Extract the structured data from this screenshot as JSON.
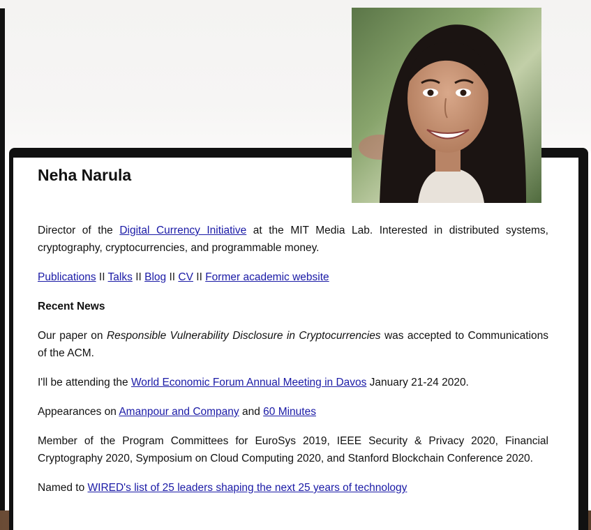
{
  "profile": {
    "name": "Neha Narula",
    "photo_alt": "portrait-photo"
  },
  "intro": {
    "before": "Director of the ",
    "link": "Digital Currency Initiative",
    "after": " at the MIT Media Lab. Interested in distributed systems, cryptography, cryptocurrencies, and programmable money."
  },
  "nav_links": {
    "separator": "II",
    "items": [
      "Publications",
      "Talks",
      "Blog",
      "CV",
      "Former academic website"
    ]
  },
  "news": {
    "heading": "Recent News",
    "item1": {
      "before": "Our paper on ",
      "title": "Responsible Vulnerability Disclosure in Cryptocurrencies",
      "after": " was accepted to Communications of the ACM."
    },
    "item2": {
      "before": "I'll be attending the ",
      "link": "World Economic Forum Annual Meeting in Davos",
      "after": " January 21-24 2020."
    },
    "item3": {
      "before": "Appearances on ",
      "link1": "Amanpour and Company",
      "middle": " and ",
      "link2": "60 Minutes"
    },
    "item4": {
      "text": "Member of the Program Committees for EuroSys 2019, IEEE Security & Privacy 2020, Financial Cryptography 2020, Symposium on Cloud Computing 2020, and Stanford Blockchain Conference 2020."
    },
    "item5": {
      "before": "Named to ",
      "link": "WIRED's list of 25 leaders shaping the next 25 years of technology"
    }
  }
}
